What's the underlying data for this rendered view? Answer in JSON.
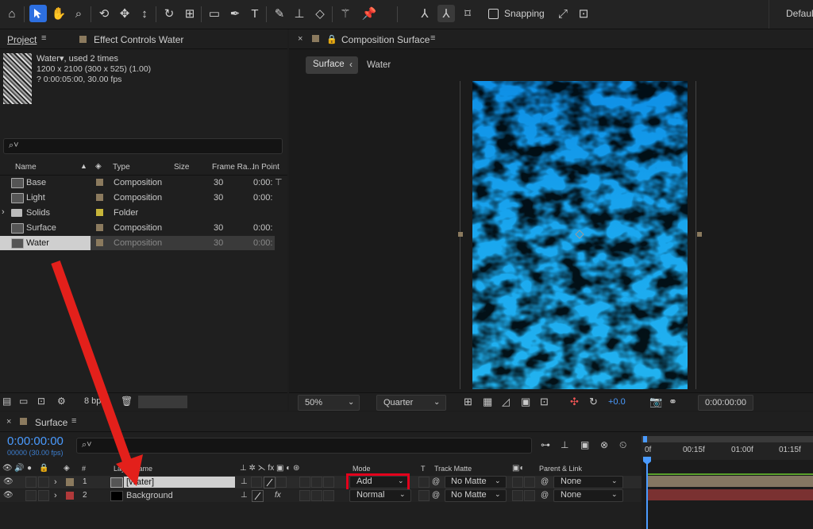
{
  "toolbar": {
    "snapping_label": "Snapping",
    "workspace_label": "Default"
  },
  "project": {
    "tab_label": "Project",
    "effect_controls_label": "Effect Controls Water",
    "item_name": "Water",
    "item_used": ", used 2 times",
    "item_dims": "1200 x 2100  (300 x 525) (1.00)",
    "item_duration": "? 0:00:05:00, 30.00 fps",
    "search_placeholder": "",
    "columns": {
      "name": "Name",
      "type": "Type",
      "size": "Size",
      "frame_rate": "Frame Ra...",
      "in_point": "In Point"
    },
    "items": [
      {
        "name": "Base",
        "type": "Composition",
        "frame_rate": "30",
        "in_point": "0:00:",
        "swatch": "#8b7a5e"
      },
      {
        "name": "Light",
        "type": "Composition",
        "frame_rate": "30",
        "in_point": "0:00:",
        "swatch": "#8b7a5e"
      },
      {
        "name": "Solids",
        "type": "Folder",
        "frame_rate": "",
        "in_point": "",
        "swatch": "#c8b63a"
      },
      {
        "name": "Surface",
        "type": "Composition",
        "frame_rate": "30",
        "in_point": "0:00:",
        "swatch": "#8b7a5e"
      },
      {
        "name": "Water",
        "type": "Composition",
        "frame_rate": "30",
        "in_point": "0:00:",
        "swatch": "#8b7a5e"
      }
    ],
    "bpc_label": "8 bpc"
  },
  "composition": {
    "tab_label": "Composition Surface",
    "breadcrumb": [
      "Surface",
      "Water"
    ],
    "zoom": "50%",
    "resolution": "Quarter",
    "exposure": "+0.0",
    "timecode": "0:00:00:00"
  },
  "timeline": {
    "tab_label": "Surface",
    "timecode": "0:00:00:00",
    "fps": "00000 (30.00 fps)",
    "ruler": [
      "0f",
      "00:15f",
      "01:00f",
      "01:15f"
    ],
    "columns": {
      "layer_name": "Layer Name",
      "number": "#",
      "mode": "Mode",
      "t": "T",
      "track_matte": "Track Matte",
      "parent_link": "Parent & Link"
    },
    "layers": [
      {
        "number": "1",
        "name": "[Water]",
        "mode": "Add",
        "matte": "No Matte",
        "parent": "None",
        "color": "#8b7a5e"
      },
      {
        "number": "2",
        "name": "Background",
        "mode": "Normal",
        "matte": "No Matte",
        "parent": "None",
        "color": "#b0393a"
      }
    ]
  },
  "colors": {
    "accent_blue": "#2d6fe0",
    "highlight_red": "#e3001b",
    "arrow_red": "#e3201b"
  }
}
